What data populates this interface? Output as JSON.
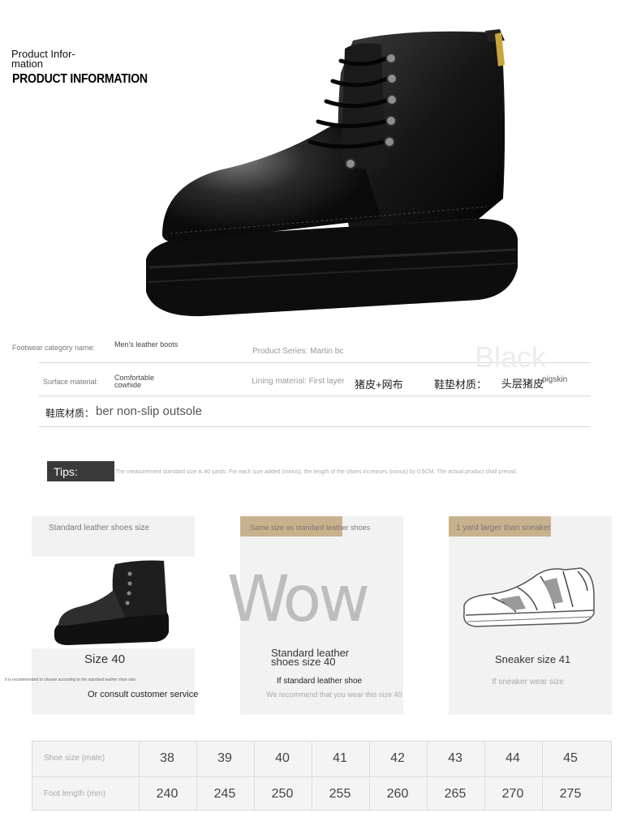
{
  "header": {
    "title_small": "Product Infor-mation",
    "title_big": "PRODUCT INFORMATION"
  },
  "specs": {
    "row1": {
      "label": "Footwear category name:",
      "value": "Men's leather boots",
      "mid": "Product Series: Martin bc"
    },
    "row2": {
      "label": "Surface material:",
      "value": "Comfortable cowhide",
      "mid": "Lining material: First layer",
      "cjk_lining": "猪皮+网布",
      "cjk_insole": "鞋垫材质：",
      "cjk_head": "头层猪皮",
      "insole_value": "pigskin"
    },
    "row3": {
      "cjk_prefix": "鞋底材质：",
      "value": "ber non-slip outsole"
    },
    "ghost_text": "Black"
  },
  "tips": {
    "label": "Tips:",
    "text": "The measurement standard size is 40 yards. For each size added (minus), the length of the shoes increases (minus) by 0.5CM. The actual product shall prevail."
  },
  "cards": [
    {
      "tab": "Standard leather shoes size",
      "size": "Size 40",
      "note": "It is recommended to choose according to the standard leather shoe size.",
      "sub": "Or consult customer service"
    },
    {
      "tab": "Same size as standard leather shoes",
      "wow": "Wow",
      "size": "Standard leather shoes size 40",
      "sub": "If standard leather shoe",
      "note": "We recommend that you wear this size 40"
    },
    {
      "tab": "1 yard larger than sneaker",
      "size": "Sneaker size 41",
      "note": "If sneaker wear size"
    }
  ],
  "size_table": {
    "row_labels": [
      "Shoe size (male)",
      "Foot length (mm)"
    ],
    "sizes": [
      "38",
      "39",
      "40",
      "41",
      "42",
      "43",
      "44",
      "45"
    ],
    "lengths": [
      "240",
      "245",
      "250",
      "255",
      "260",
      "265",
      "270",
      "275"
    ]
  },
  "colors": {
    "tab_accent": "#c8b28e",
    "tips_bg": "#3a3a3a",
    "card_bg": "#f2f2f2"
  }
}
